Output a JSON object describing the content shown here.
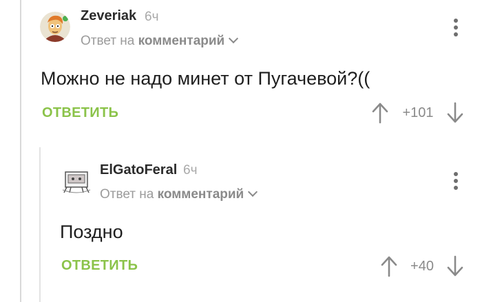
{
  "comments": [
    {
      "author": "Zeveriak",
      "time": "6ч",
      "reply_prefix": "Ответ на",
      "reply_link": "комментарий",
      "text": "Можно не надо минет от Пугачевой?((",
      "reply_button": "ОТВЕТИТЬ",
      "rating": "+101"
    },
    {
      "author": "ElGatoFeral",
      "time": "6ч",
      "reply_prefix": "Ответ на",
      "reply_link": "комментарий",
      "text": "Поздно",
      "reply_button": "ОТВЕТИТЬ",
      "rating": "+40"
    }
  ],
  "icons": {
    "menu": "more-vert-icon",
    "upvote": "arrow-up-icon",
    "downvote": "arrow-down-icon",
    "expand": "chevron-down-icon"
  },
  "colors": {
    "accent": "#8bc34a",
    "muted": "#9b9b9b",
    "thread_line": "#d9d9d9"
  }
}
